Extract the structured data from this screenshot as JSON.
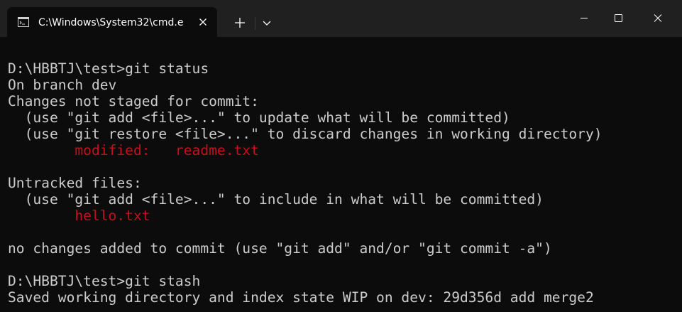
{
  "tab": {
    "title": "C:\\Windows\\System32\\cmd.e",
    "icon": "terminal-icon"
  },
  "colors": {
    "titlebar": "#202020",
    "background": "#0c0c0c",
    "text": "#cccccc",
    "red": "#c50f1f"
  },
  "terminal": {
    "lines": [
      {
        "text": "D:\\HBBTJ\\test>git status"
      },
      {
        "text": "On branch dev"
      },
      {
        "text": "Changes not staged for commit:"
      },
      {
        "text": "  (use \"git add <file>...\" to update what will be committed)"
      },
      {
        "text": "  (use \"git restore <file>...\" to discard changes in working directory)"
      },
      {
        "indent": "        ",
        "text": "modified:   readme.txt",
        "color": "red"
      },
      {
        "text": ""
      },
      {
        "text": "Untracked files:"
      },
      {
        "text": "  (use \"git add <file>...\" to include in what will be committed)"
      },
      {
        "indent": "        ",
        "text": "hello.txt",
        "color": "red"
      },
      {
        "text": ""
      },
      {
        "text": "no changes added to commit (use \"git add\" and/or \"git commit -a\")"
      },
      {
        "text": ""
      },
      {
        "text": "D:\\HBBTJ\\test>git stash"
      },
      {
        "text": "Saved working directory and index state WIP on dev: 29d356d add merge2"
      }
    ]
  }
}
